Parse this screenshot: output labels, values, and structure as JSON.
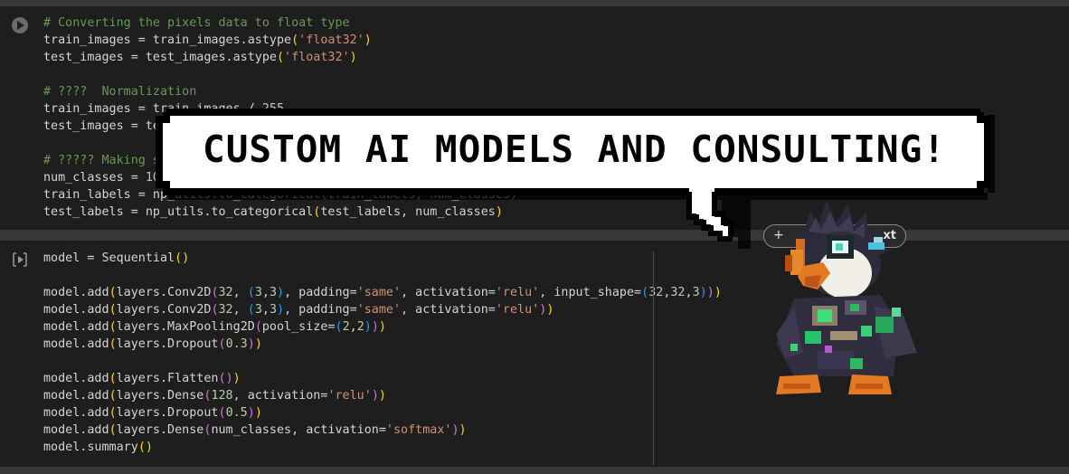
{
  "cells": [
    {
      "id": "cell1",
      "lines": [
        "# Converting the pixels data to float type",
        "train_images = train_images.astype('float32')",
        "test_images = test_images.astype('float32')",
        "",
        "# ????  Normalization",
        "train_images = train_images / 255",
        "test_images = test_images / 255",
        "",
        "# ????? Making sure that the values are float so that we can get decimal points after division",
        "num_classes = 10",
        "train_labels = np_utils.to_categorical(train_labels, num_classes)",
        "test_labels = np_utils.to_categorical(test_labels, num_classes)"
      ]
    },
    {
      "id": "cell2",
      "lines": [
        "model = Sequential()",
        "",
        "model.add(layers.Conv2D(32, (3,3), padding='same', activation='relu', input_shape=(32,32,3)))",
        "model.add(layers.Conv2D(32, (3,3), padding='same', activation='relu'))",
        "model.add(layers.MaxPooling2D(pool_size=(2,2)))",
        "model.add(layers.Dropout(0.3))",
        "",
        "model.add(layers.Flatten())",
        "model.add(layers.Dense(128, activation='relu'))",
        "model.add(layers.Dropout(0.5))",
        "model.add(layers.Dense(num_classes, activation='softmax'))",
        "model.summary()"
      ]
    }
  ],
  "speech_bubble": {
    "text": "CUSTOM AI MODELS AND CONSULTING!"
  },
  "add_pill": {
    "plus": "+",
    "label": "xt"
  },
  "icons": {
    "run": "play-icon",
    "mascot": "penguin-mascot-icon"
  },
  "colors": {
    "background": "#383838",
    "cell_bg": "#1e1e1e",
    "comment": "#6a9955",
    "string": "#ce9178",
    "number": "#b5cea8",
    "bracket1": "#ffd700",
    "bracket2": "#da70d6",
    "bracket3": "#179fff"
  }
}
